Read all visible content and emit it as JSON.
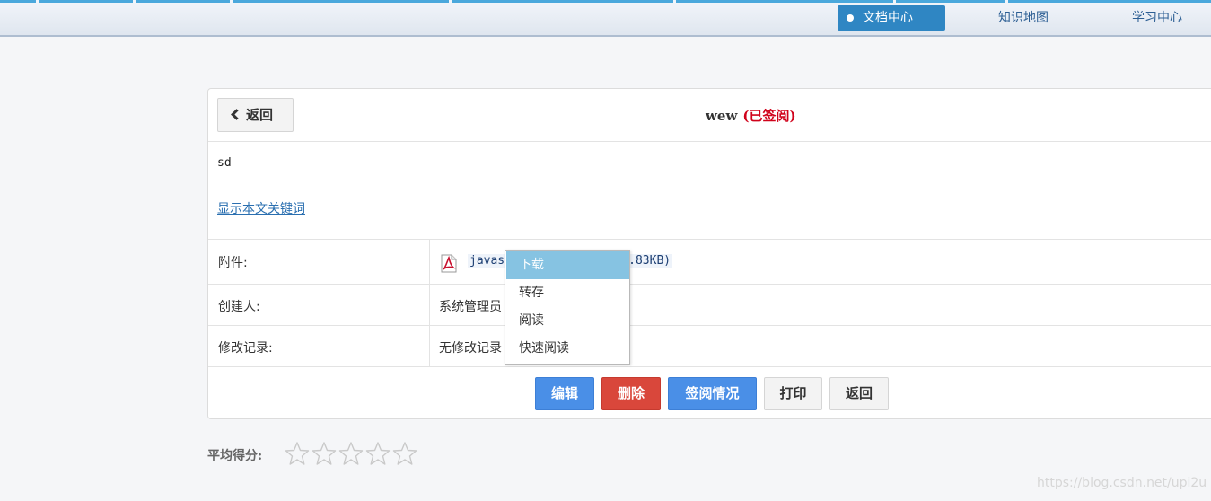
{
  "nav": {
    "items": [
      {
        "label": "文档中心",
        "active": true
      },
      {
        "label": "知识地图",
        "active": false
      },
      {
        "label": "学习中心",
        "active": false
      }
    ]
  },
  "document": {
    "back_label": "返回",
    "title": "wew",
    "status": "(已签阅)",
    "content": "sd",
    "keyword_link": "显示本文关键词"
  },
  "details": {
    "attachment_label": "附件:",
    "attachment_file": "javas",
    "attachment_size": ".83KB)",
    "creator_label": "创建人:",
    "creator_value": "系统管理员",
    "history_label": "修改记录:",
    "history_value": "无修改记录"
  },
  "context_menu": {
    "items": [
      "下载",
      "转存",
      "阅读",
      "快速阅读"
    ],
    "highlighted": 0
  },
  "actions": {
    "edit": "编辑",
    "delete": "删除",
    "sign_status": "签阅情况",
    "print": "打印",
    "back": "返回"
  },
  "rating": {
    "label": "平均得分:",
    "max": 5,
    "value": 0
  },
  "watermark": "https://blog.csdn.net/upi2u",
  "colors": {
    "nav_active": "#2f86c3",
    "status_red": "#d0021b",
    "button_blue": "#4a8fe7",
    "button_red": "#d9473b",
    "menu_highlight": "#86c3e2"
  }
}
